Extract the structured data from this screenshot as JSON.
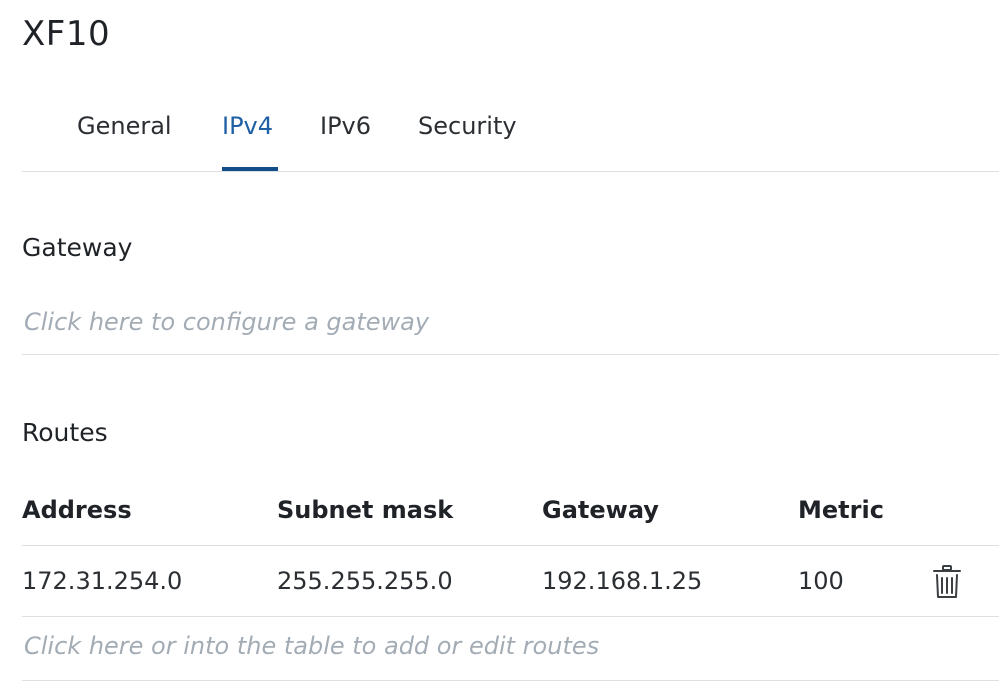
{
  "page": {
    "title": "XF10"
  },
  "tabs": [
    {
      "label": "General",
      "active": false
    },
    {
      "label": "IPv4",
      "active": true
    },
    {
      "label": "IPv6",
      "active": false
    },
    {
      "label": "Security",
      "active": false
    }
  ],
  "gateway": {
    "heading": "Gateway",
    "hint": "Click here to configure a gateway"
  },
  "routes": {
    "heading": "Routes",
    "columns": [
      "Address",
      "Subnet mask",
      "Gateway",
      "Metric"
    ],
    "rows": [
      {
        "address": "172.31.254.0",
        "subnet_mask": "255.255.255.0",
        "gateway": "192.168.1.25",
        "metric": "100",
        "action_icon": "trash-icon"
      }
    ],
    "hint": "Click here or into the table to add or edit routes"
  },
  "colors": {
    "accent": "#124d8a",
    "active_tab_text": "#1f5fa3",
    "hint_text": "#a3acb5",
    "divider": "#dde0e3"
  }
}
